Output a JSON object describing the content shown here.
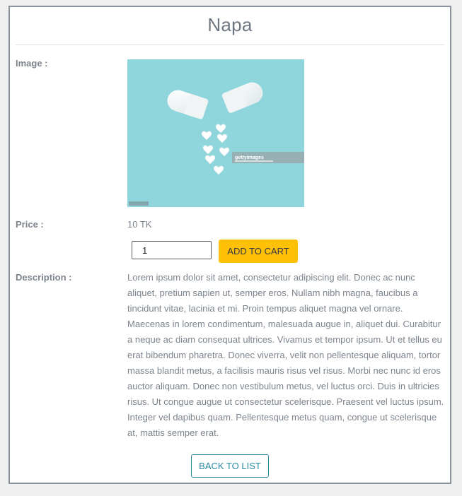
{
  "product": {
    "name": "Napa",
    "image_label": "Image :",
    "price_label": "Price :",
    "price_value": "10 TK",
    "description_label": "Description :",
    "description": "Lorem ipsum dolor sit amet, consectetur adipiscing elit. Donec ac nunc aliquet, pretium sapien ut, semper eros. Nullam nibh magna, faucibus a tincidunt vitae, lacinia et mi. Proin tempus aliquet magna vel ornare. Maecenas in lorem condimentum, malesuada augue in, aliquet dui. Curabitur a neque ac diam consequat ultrices. Vivamus et tempor ipsum. Ut et tellus eu erat bibendum pharetra. Donec viverra, velit non pellentesque aliquam, tortor massa blandit metus, a facilisis mauris risus vel risus. Morbi nec nunc id eros auctor aliquam. Donec non vestibulum metus, vel luctus orci. Duis in ultricies risus. Ut congue augue ut consectetur scelerisque. Praesent vel luctus ipsum. Integer vel dapibus quam. Pellentesque metus quam, congue ut scelerisque at, mattis semper erat.",
    "image_watermark": "gettyimages"
  },
  "cart": {
    "quantity": "1",
    "add_label": "ADD TO CART"
  },
  "nav": {
    "back_label": "BACK TO LIST"
  },
  "colors": {
    "accent": "#ffc107",
    "link": "#2b8aa3",
    "image_bg": "#8fd6dc"
  }
}
